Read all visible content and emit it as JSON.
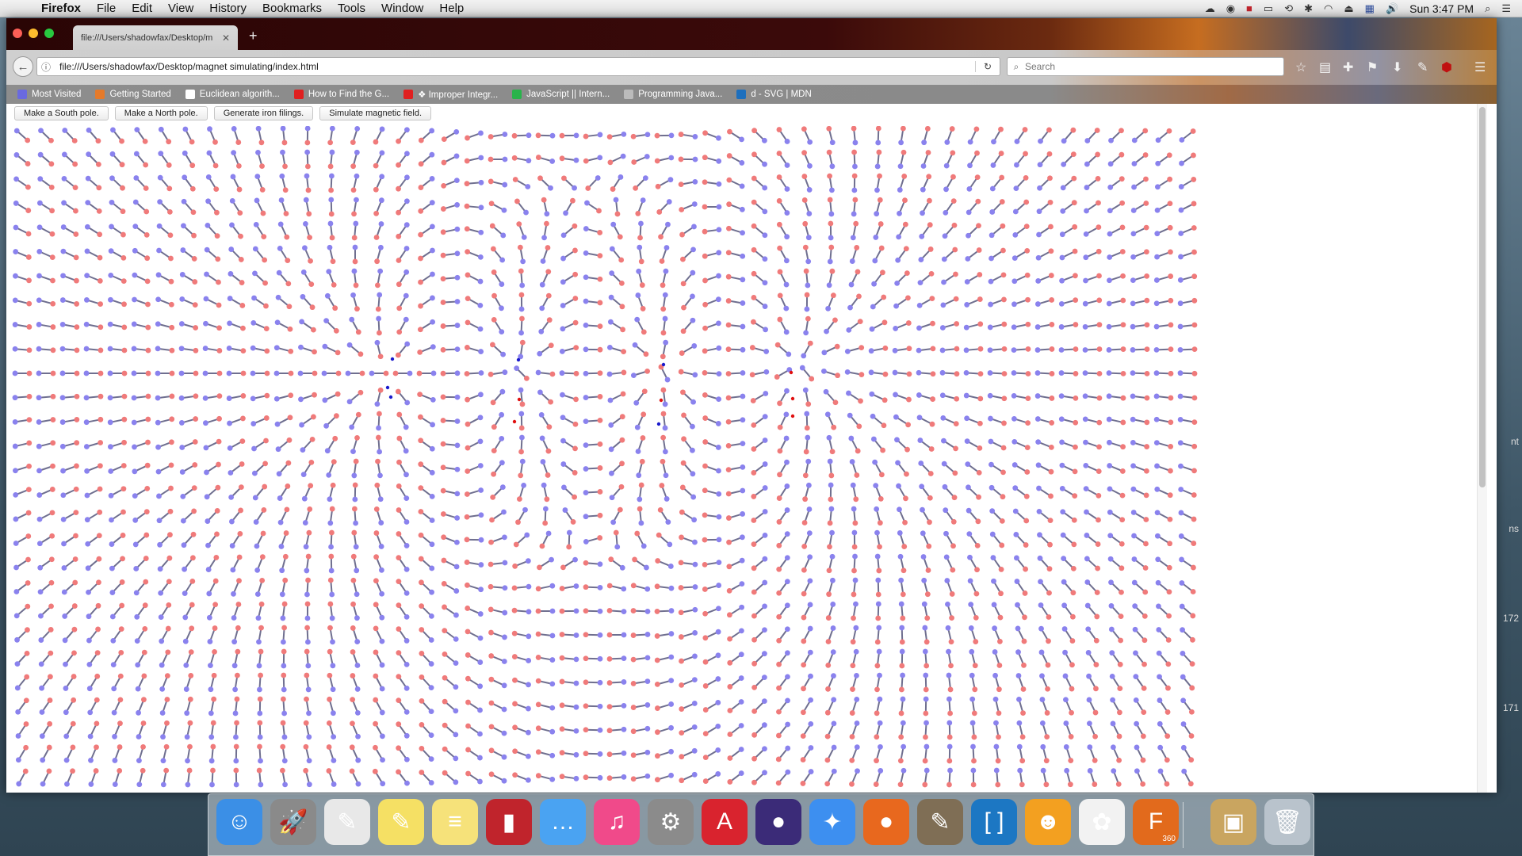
{
  "menubar": {
    "app": "Firefox",
    "items": [
      "File",
      "Edit",
      "View",
      "History",
      "Bookmarks",
      "Tools",
      "Window",
      "Help"
    ],
    "clock": "Sun 3:47 PM"
  },
  "browser": {
    "tab_title": "file:///Users/shadowfax/Desktop/m",
    "url": "file:///Users/shadowfax/Desktop/magnet simulating/index.html",
    "search_placeholder": "Search",
    "bookmarks": [
      {
        "label": "Most Visited",
        "icon": "most-visited-icon",
        "color": "#6a6adf"
      },
      {
        "label": "Getting Started",
        "icon": "firefox-icon",
        "color": "#e57a2a"
      },
      {
        "label": "Euclidean algorith...",
        "icon": "wikipedia-icon",
        "color": "#ffffff"
      },
      {
        "label": "How to Find the G...",
        "icon": "youtube-icon",
        "color": "#e02020"
      },
      {
        "label": "❖ Improper Integr...",
        "icon": "youtube-icon",
        "color": "#e02020"
      },
      {
        "label": "JavaScript || Intern...",
        "icon": "codecademy-icon",
        "color": "#28b34a"
      },
      {
        "label": "Programming Java...",
        "icon": "gear-icon",
        "color": "#bbbbbb"
      },
      {
        "label": "d - SVG | MDN",
        "icon": "mdn-icon",
        "color": "#1d6fbd"
      }
    ]
  },
  "page": {
    "buttons": [
      "Make a South pole.",
      "Make a North pole.",
      "Generate iron filings.",
      "Simulate magnetic field."
    ]
  },
  "field": {
    "north_color": "#f07a7a",
    "south_color": "#8a82ee",
    "line_color": "#6f6f8f",
    "pole_north_color": "#e01010",
    "pole_south_color": "#1a1acc"
  },
  "desktop": {
    "side_text": [
      "nt",
      "ns",
      "172",
      "171"
    ]
  },
  "dock": {
    "apps": [
      {
        "name": "finder",
        "color": "#3b8fe6",
        "glyph": "☺"
      },
      {
        "name": "launchpad",
        "color": "#8a8a8a",
        "glyph": "🚀"
      },
      {
        "name": "textedit",
        "color": "#e8e8e8",
        "glyph": "✎"
      },
      {
        "name": "stickies",
        "color": "#f5e064",
        "glyph": "✎"
      },
      {
        "name": "notes",
        "color": "#f6e27a",
        "glyph": "≡"
      },
      {
        "name": "photobooth",
        "color": "#c0242c",
        "glyph": "▮"
      },
      {
        "name": "messages",
        "color": "#4aa3f2",
        "glyph": "…"
      },
      {
        "name": "itunes",
        "color": "#f04a8a",
        "glyph": "♫"
      },
      {
        "name": "system-preferences",
        "color": "#8b8b8b",
        "glyph": "⚙"
      },
      {
        "name": "autocad",
        "color": "#d9232e",
        "glyph": "A"
      },
      {
        "name": "eclipse",
        "color": "#3b2b78",
        "glyph": "●"
      },
      {
        "name": "safari",
        "color": "#3d8ff0",
        "glyph": "✦"
      },
      {
        "name": "firefox",
        "color": "#e8681e",
        "glyph": "●"
      },
      {
        "name": "gimp",
        "color": "#7f6e55",
        "glyph": "✎"
      },
      {
        "name": "brackets",
        "color": "#1c77c3",
        "glyph": "[ ]"
      },
      {
        "name": "scratch",
        "color": "#f3a020",
        "glyph": "☻"
      },
      {
        "name": "photos",
        "color": "#f2f2f2",
        "glyph": "✿"
      },
      {
        "name": "fusion-360",
        "color": "#e26a1c",
        "glyph": "F"
      },
      {
        "name": "installer",
        "color": "#c9a560",
        "glyph": "▣"
      },
      {
        "name": "trash",
        "color": "#b9c3cc",
        "glyph": "🗑"
      }
    ],
    "fusion_badge": "360"
  }
}
